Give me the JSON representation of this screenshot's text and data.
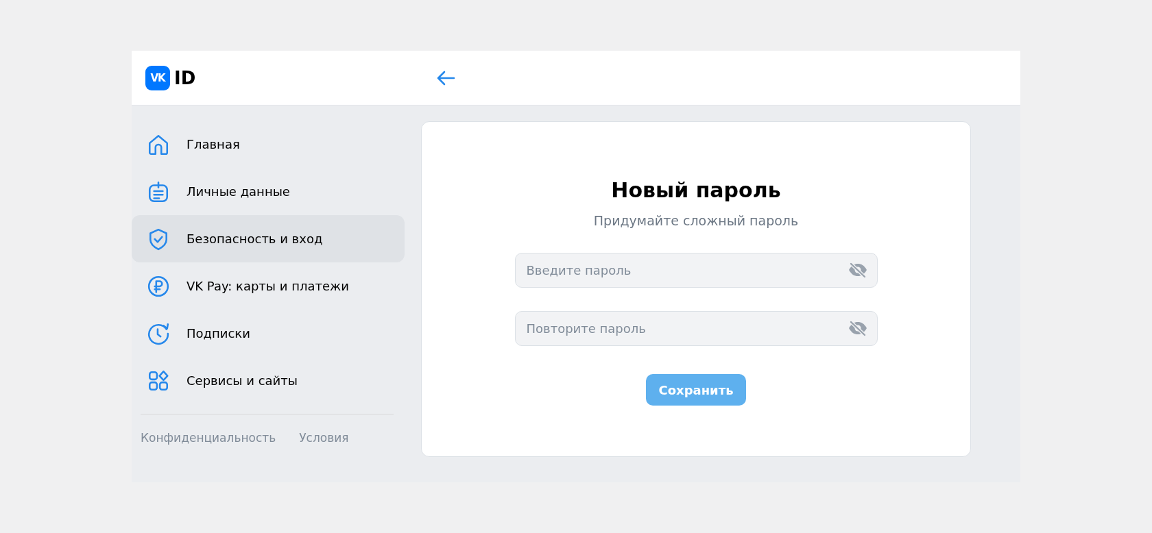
{
  "header": {
    "logo_mark": "VK",
    "logo_text": "ID"
  },
  "sidebar": {
    "items": [
      {
        "label": "Главная",
        "kind": "home",
        "selected": false
      },
      {
        "label": "Личные данные",
        "kind": "profile",
        "selected": false
      },
      {
        "label": "Безопасность и вход",
        "kind": "security",
        "selected": true
      },
      {
        "label": "VK Pay: карты и платежи",
        "kind": "payments",
        "selected": false
      },
      {
        "label": "Подписки",
        "kind": "subscriptions",
        "selected": false
      },
      {
        "label": "Сервисы и сайты",
        "kind": "services",
        "selected": false
      }
    ],
    "footer_links": [
      "Конфиденциальность",
      "Условия"
    ]
  },
  "form": {
    "title": "Новый пароль",
    "subtitle": "Придумайте сложный пароль",
    "fields": [
      {
        "placeholder": "Введите пароль"
      },
      {
        "placeholder": "Повторите пароль"
      }
    ],
    "save_button": {
      "label": "Сохранить",
      "disabled": true
    }
  }
}
